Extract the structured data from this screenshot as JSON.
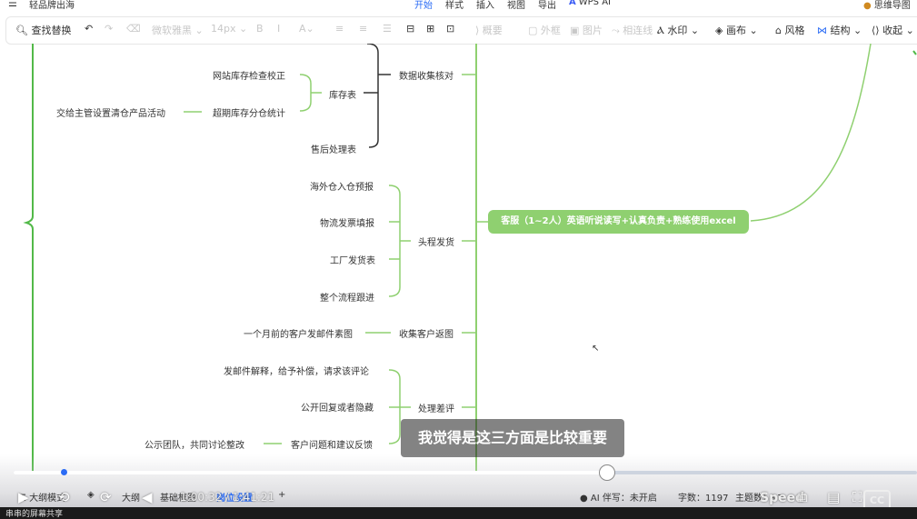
{
  "app": {
    "doc_title": "轻品牌出海",
    "tabs": [
      "开始",
      "样式",
      "插入",
      "视图",
      "导出"
    ],
    "active_tab": "开始",
    "wps_ai": "WPS AI",
    "brand": "思维导图"
  },
  "toolbar": {
    "find_replace": "查找替换",
    "font": "微软雅黑",
    "font_size": "14px",
    "summary": "概要",
    "outline": "外框",
    "image": "图片",
    "association": "相连线",
    "watermark": "水印",
    "canvas": "画布",
    "style": "风格",
    "structure": "结构",
    "collapse": "收起"
  },
  "mindmap": {
    "branch_main": "客服（1~2人）英语听说读写+认真负责+熟练使用excel",
    "groups": {
      "data_check": "数据收集核对",
      "first_leg": "头程发货",
      "collect_feedback": "收集客户返图",
      "bad_review": "处理差评"
    },
    "nodes": {
      "inventory_table": "库存表",
      "site_inventory": "网站库存检查校正",
      "overdue_inventory": "超期库存分仓统计",
      "clearance": "交给主管设置清仓产品活动",
      "after_sales": "售后处理表",
      "overseas_forecast": "海外仓入仓预报",
      "logistics_invoice": "物流发票填报",
      "factory_shipping": "工厂发货表",
      "process_follow": "整个流程跟进",
      "email_material": "一个月前的客户发邮件素图",
      "email_explain": "发邮件解释，给予补偿，请求该评论",
      "public_reply": "公开回复或者隐藏",
      "customer_issue": "客户问题和建议反馈",
      "team_discuss": "公示团队，共同讨论整改"
    }
  },
  "video": {
    "subtitle": "我觉得是这三方面是比较重要",
    "timecode": "1:00:32 / 1:41:21",
    "speed": "Speed",
    "cc": "CC",
    "progress": 0.656
  },
  "statusbar": {
    "outline": "大纲模式",
    "outline_short": "大纲",
    "basic_chart": "基础框图",
    "position": "岗位设置",
    "ai_assist": "AI 伴写：未开启",
    "word_count": "字数：1197",
    "topic_count": "主题数：97"
  },
  "screen_share": "串串的屏幕共享",
  "colors": {
    "accent": "#2b6cf5",
    "branch_green": "#8fd070",
    "bracket_green": "#52b948",
    "dark_line": "#333333"
  }
}
